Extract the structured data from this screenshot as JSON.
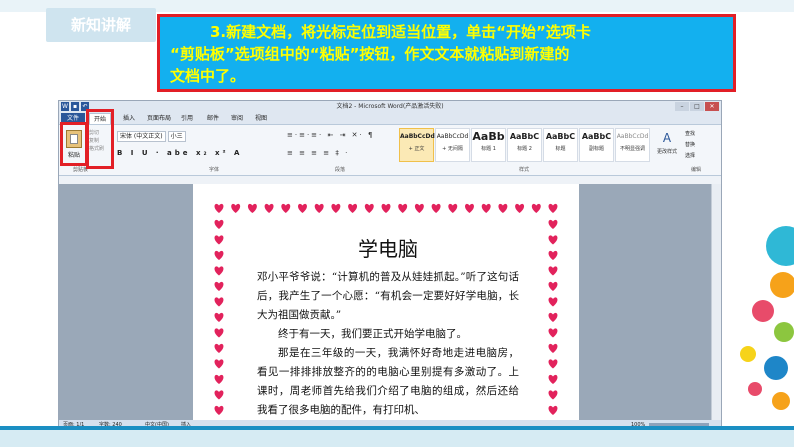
{
  "slide": {
    "badge": "新知讲解",
    "instruction": {
      "line1": "3.新建文档，将光标定位到适当位置，单击“开始”选项卡",
      "line2": "“剪贴板”选项组中的“粘贴”按钮，作文文本就粘贴到新建的",
      "line3": "文档中了。"
    }
  },
  "word": {
    "title": "文档2 - Microsoft Word(产品激活失败)",
    "tabs": [
      "文件",
      "开始",
      "插入",
      "页面布局",
      "引用",
      "邮件",
      "审阅",
      "视图"
    ],
    "clipboard": {
      "paste_label": "粘贴",
      "cut": "剪切",
      "copy": "复制",
      "format_painter": "格式刷",
      "group_label": "剪贴板"
    },
    "font": {
      "name": "宋体 (中文正文)",
      "size": "小三",
      "group_label": "字体",
      "format_buttons": "B I U · abe x₂ x² A"
    },
    "paragraph": {
      "group_label": "段落",
      "row1": "≡·≡·≡· ⇤ ⇥ ✕· ¶",
      "row2": "≡ ≡ ≡ ≡ ‡ ·"
    },
    "styles": {
      "group_label": "样式",
      "items": [
        {
          "sample": "AaBbCcDd",
          "name": "+ 正文"
        },
        {
          "sample": "AaBbCcDd",
          "name": "+ 无间隔"
        },
        {
          "sample": "AaBb",
          "name": "标题 1"
        },
        {
          "sample": "AaBbC",
          "name": "标题 2"
        },
        {
          "sample": "AaBbC",
          "name": "标题"
        },
        {
          "sample": "AaBbC",
          "name": "副标题"
        },
        {
          "sample": "AaBbCcDd",
          "name": "不明显强调"
        }
      ],
      "change_styles": "更改样式"
    },
    "editing": {
      "find": "查找",
      "replace": "替换",
      "select": "选择",
      "group_label": "编辑"
    },
    "document": {
      "title": "学电脑",
      "paragraphs": [
        "邓小平爷爷说：“计算机的普及从娃娃抓起。”听了这句话后，我产生了一个心愿：“有机会一定要好好学电脑，长大为祖国做贡献。”",
        "终于有一天，我们要正式开始学电脑了。",
        "那是在三年级的一天，我满怀好奇地走进电脑房，看见一排排排放整齐的的电脑心里别提有多激动了。上课时，周老师首先给我们介绍了电脑的组成，然后还给我看了很多电脑的配件，有打印机、"
      ]
    },
    "status": {
      "page": "页面: 1/1",
      "words": "字数: 240",
      "lang": "中文(中国)",
      "mode": "插入",
      "zoom": "100%"
    }
  },
  "colors": {
    "instruction_bg": "#13b0ef",
    "instruction_text": "#ffff00",
    "highlight_border": "#e21f26",
    "heart": "#e2225c"
  }
}
